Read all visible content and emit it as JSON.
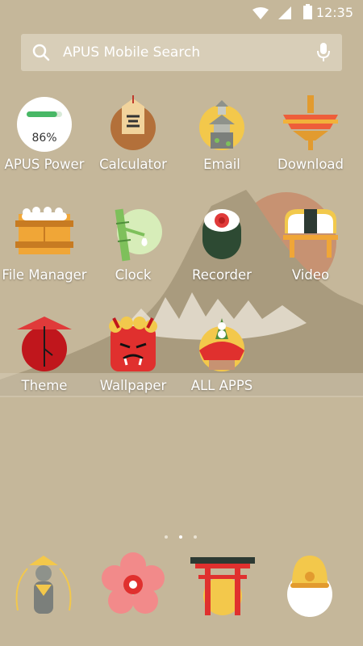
{
  "status": {
    "time": "12:35"
  },
  "search": {
    "placeholder": "APUS Mobile Search"
  },
  "apps": [
    {
      "label": "APUS Power",
      "percent_text": "86%",
      "battery_level": 0.86
    },
    {
      "label": "Calculator"
    },
    {
      "label": "Email"
    },
    {
      "label": "Download"
    },
    {
      "label": "File Manager"
    },
    {
      "label": "Clock"
    },
    {
      "label": "Recorder"
    },
    {
      "label": "Video"
    },
    {
      "label": "Theme"
    },
    {
      "label": "Wallpaper"
    },
    {
      "label": "ALL APPS"
    }
  ],
  "page_indicator": {
    "count": 3,
    "active": 2
  },
  "colors": {
    "background": "#c5b79a",
    "mountain": "#a99b7e",
    "sun": "#c79272"
  },
  "icons": [
    "search-icon",
    "mic-icon",
    "wifi-icon",
    "signal-icon",
    "battery-icon",
    "jizo-icon",
    "plum-flower-icon",
    "torii-icon",
    "bell-icon"
  ]
}
